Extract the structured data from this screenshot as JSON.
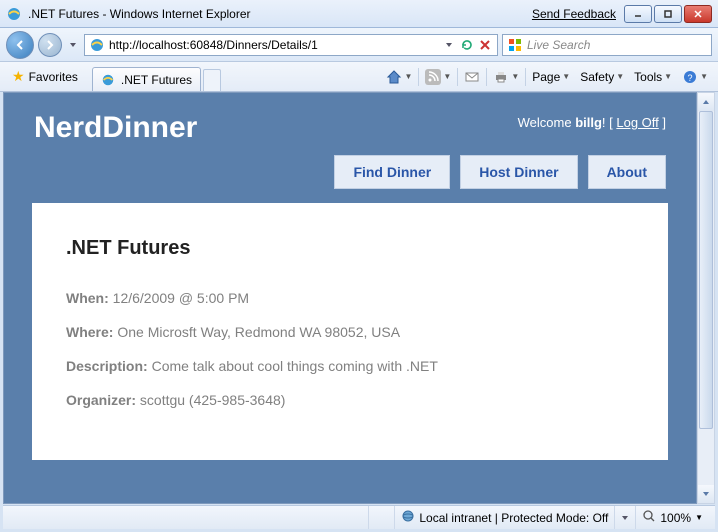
{
  "window": {
    "title": ".NET Futures - Windows Internet Explorer",
    "feedback": "Send Feedback"
  },
  "address": {
    "url": "http://localhost:60848/Dinners/Details/1"
  },
  "search": {
    "placeholder": "Live Search"
  },
  "fav": {
    "label": "Favorites"
  },
  "tab": {
    "label": ".NET Futures"
  },
  "menu": {
    "page": "Page",
    "safety": "Safety",
    "tools": "Tools"
  },
  "site": {
    "brand": "NerdDinner",
    "welcome_prefix": "Welcome ",
    "user": "billg",
    "welcome_suffix": "! [ ",
    "logoff": "Log Off",
    "welcome_end": " ]",
    "nav": {
      "find": "Find Dinner",
      "host": "Host Dinner",
      "about": "About"
    }
  },
  "dinner": {
    "title": ".NET Futures",
    "when_label": "When:",
    "when": " 12/6/2009 @ 5:00 PM",
    "where_label": "Where:",
    "where": " One Microsft Way, Redmond WA 98052, USA",
    "desc_label": "Description:",
    "desc": " Come talk about cool things coming with .NET",
    "org_label": "Organizer:",
    "org": " scottgu (425-985-3648)"
  },
  "status": {
    "zone": "Local intranet | Protected Mode: Off",
    "zoom": "100%"
  }
}
